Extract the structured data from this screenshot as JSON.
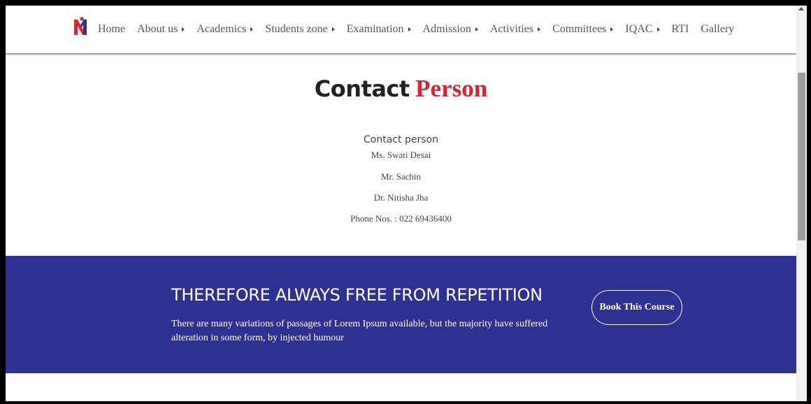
{
  "nav": {
    "items": [
      {
        "label": "Home",
        "caret": false
      },
      {
        "label": "About us",
        "caret": true
      },
      {
        "label": "Academics",
        "caret": true
      },
      {
        "label": "Students zone",
        "caret": true
      },
      {
        "label": "Examination",
        "caret": true
      },
      {
        "label": "Admission",
        "caret": true
      },
      {
        "label": "Activities",
        "caret": true
      },
      {
        "label": "Committees",
        "caret": true
      },
      {
        "label": "IQAC",
        "caret": true
      },
      {
        "label": "RTI",
        "caret": false
      },
      {
        "label": "Gallery",
        "caret": false
      }
    ]
  },
  "main": {
    "title_part1": "Contact",
    "title_part2": "Person",
    "contact_heading": "Contact person",
    "people": [
      "Ms. Swati Desai",
      "Mr. Sachin",
      "Dr. Nitisha Jha"
    ],
    "phone": "Phone Nos. : 022 69436400"
  },
  "banner": {
    "title": "THEREFORE ALWAYS FREE FROM REPETITION",
    "text": "There are many variations of passages of Lorem Ipsum available, but the majority have suffered alteration in some form, by injected humour",
    "button_label": "Book This Course"
  },
  "colors": {
    "accent_red": "#d9232e",
    "banner_blue": "#2e3192"
  },
  "icons": {
    "logo": "college-logo-icon",
    "caret": "caret-right-icon"
  }
}
